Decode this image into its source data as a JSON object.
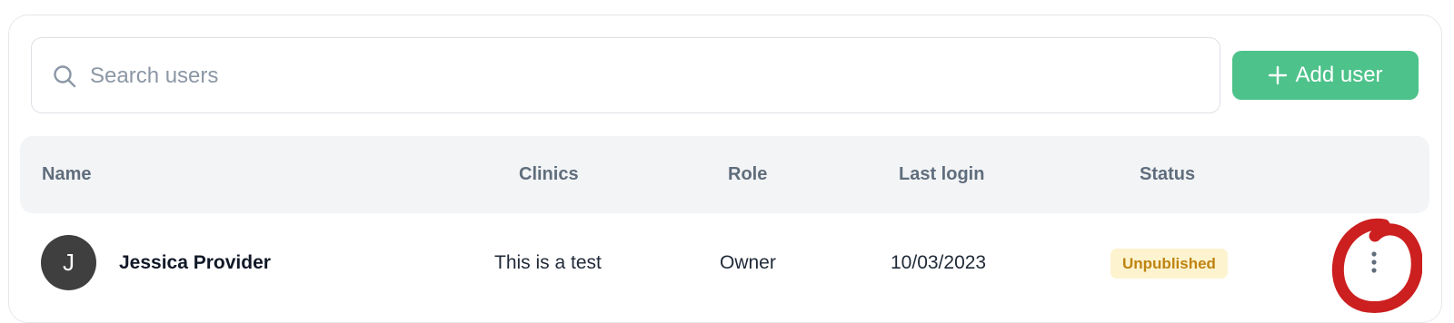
{
  "search": {
    "placeholder": "Search users",
    "value": "",
    "icon": "search-icon"
  },
  "toolbar": {
    "add_user_label": "Add user",
    "add_user_icon": "plus-icon",
    "add_user_color": "#4dc28a"
  },
  "table": {
    "columns": [
      "Name",
      "Clinics",
      "Role",
      "Last login",
      "Status"
    ],
    "rows": [
      {
        "avatar_initial": "J",
        "name": "Jessica Provider",
        "clinics": "This is a test",
        "role": "Owner",
        "last_login": "10/03/2023",
        "status": "Unpublished",
        "status_color": "#bf8310",
        "actions_icon": "more-vertical-icon"
      }
    ]
  },
  "annotation": {
    "type": "red-circle-mark",
    "color": "#cc1f1f"
  }
}
